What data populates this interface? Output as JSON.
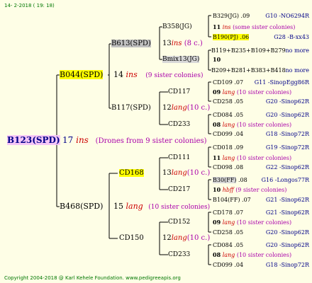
{
  "header": {
    "date": "14-  2-2018 ( 19: 18)"
  },
  "footer": {
    "copyright": "Copyright 2004-2018 @ Karl Kehele Foundation.   www.pedigreeapis.org"
  },
  "root": {
    "name": "B123(SPD)",
    "num": "17",
    "ins": "ins",
    "note": "(Drones from 9 sister colonies)"
  },
  "gen1": [
    {
      "name": "B044(SPD)",
      "num": "14",
      "ins": "ins",
      "note": "(9 sister colonies)"
    },
    {
      "name": "B468(SPD)",
      "num": "15",
      "ins": "lang",
      "note": "(10 sister colonies)"
    }
  ],
  "gen2": [
    {
      "name": "B613(SPD)",
      "num": "13",
      "ins": "ins",
      "note": "(8 c.)"
    },
    {
      "name": "B117(SPD)",
      "num": "12",
      "ins": "lang",
      "note": "(10 c.)"
    },
    {
      "name": "CD168",
      "num": "13",
      "ins": "lang",
      "note": "(10 c.)"
    },
    {
      "name": "CD150",
      "num": "12",
      "ins": "lang",
      "note": "(10 c.)"
    }
  ],
  "gen3": [
    {
      "name": "B358(JG)",
      "num": "11",
      "ins": "ins",
      "note": "(some sister colonies)"
    },
    {
      "name": "Bmix13(JG)",
      "num": "10"
    },
    {
      "name": "CD117",
      "num": "09",
      "ins": "lang",
      "note": "(10 sister colonies)"
    },
    {
      "name": "CD233",
      "num": "08",
      "ins": "lang",
      "note": "(10 sister colonies)"
    },
    {
      "name": "CD111",
      "num": "11",
      "ins": "lang",
      "note": "(10 sister colonies)"
    },
    {
      "name": "CD217",
      "num": "10",
      "ins": "hbff",
      "note": "(9 sister colonies)"
    },
    {
      "name": "CD152",
      "num": "09",
      "ins": "lang",
      "note": "(10 sister colonies)"
    },
    {
      "name": "CD233",
      "num": "08",
      "ins": "lang",
      "note": "(10 sister colonies)"
    }
  ],
  "gen4": [
    {
      "name": "B329(JG)",
      "val": ".09",
      "ref": "G10 -NO6294R"
    },
    {
      "name": "B190(PJ)",
      "val": ".06",
      "ref": "G28 -B-xx43"
    },
    {
      "name": "B119+B235+B109+B279",
      "val": "",
      "ref": "no more"
    },
    {
      "name": "B209+B281+B383+B418",
      "val": "",
      "ref": "no more"
    },
    {
      "name": "CD109",
      "val": ".07",
      "ref": "G11 -SinopEgg86R"
    },
    {
      "name": "CD258",
      "val": ".05",
      "ref": "G20 -Sinop62R"
    },
    {
      "name": "CD084",
      "val": ".05",
      "ref": "G20 -Sinop62R"
    },
    {
      "name": "CD099",
      "val": ".04",
      "ref": "G18 -Sinop72R"
    },
    {
      "name": "CD018",
      "val": ".09",
      "ref": "G19 -Sinop72R"
    },
    {
      "name": "CD098",
      "val": ".08",
      "ref": "G22 -Sinop62R"
    },
    {
      "name": "B30(FF)",
      "val": ".08",
      "ref": "G16 -Longos77R"
    },
    {
      "name": "B104(FF)",
      "val": ".07",
      "ref": "G21 -Sinop62R"
    },
    {
      "name": "CD178",
      "val": ".07",
      "ref": "G21 -Sinop62R"
    },
    {
      "name": "CD258",
      "val": ".05",
      "ref": "G20 -Sinop62R"
    },
    {
      "name": "CD084",
      "val": ".05",
      "ref": "G20 -Sinop62R"
    },
    {
      "name": "CD099",
      "val": ".04",
      "ref": "G18 -Sinop72R"
    }
  ]
}
